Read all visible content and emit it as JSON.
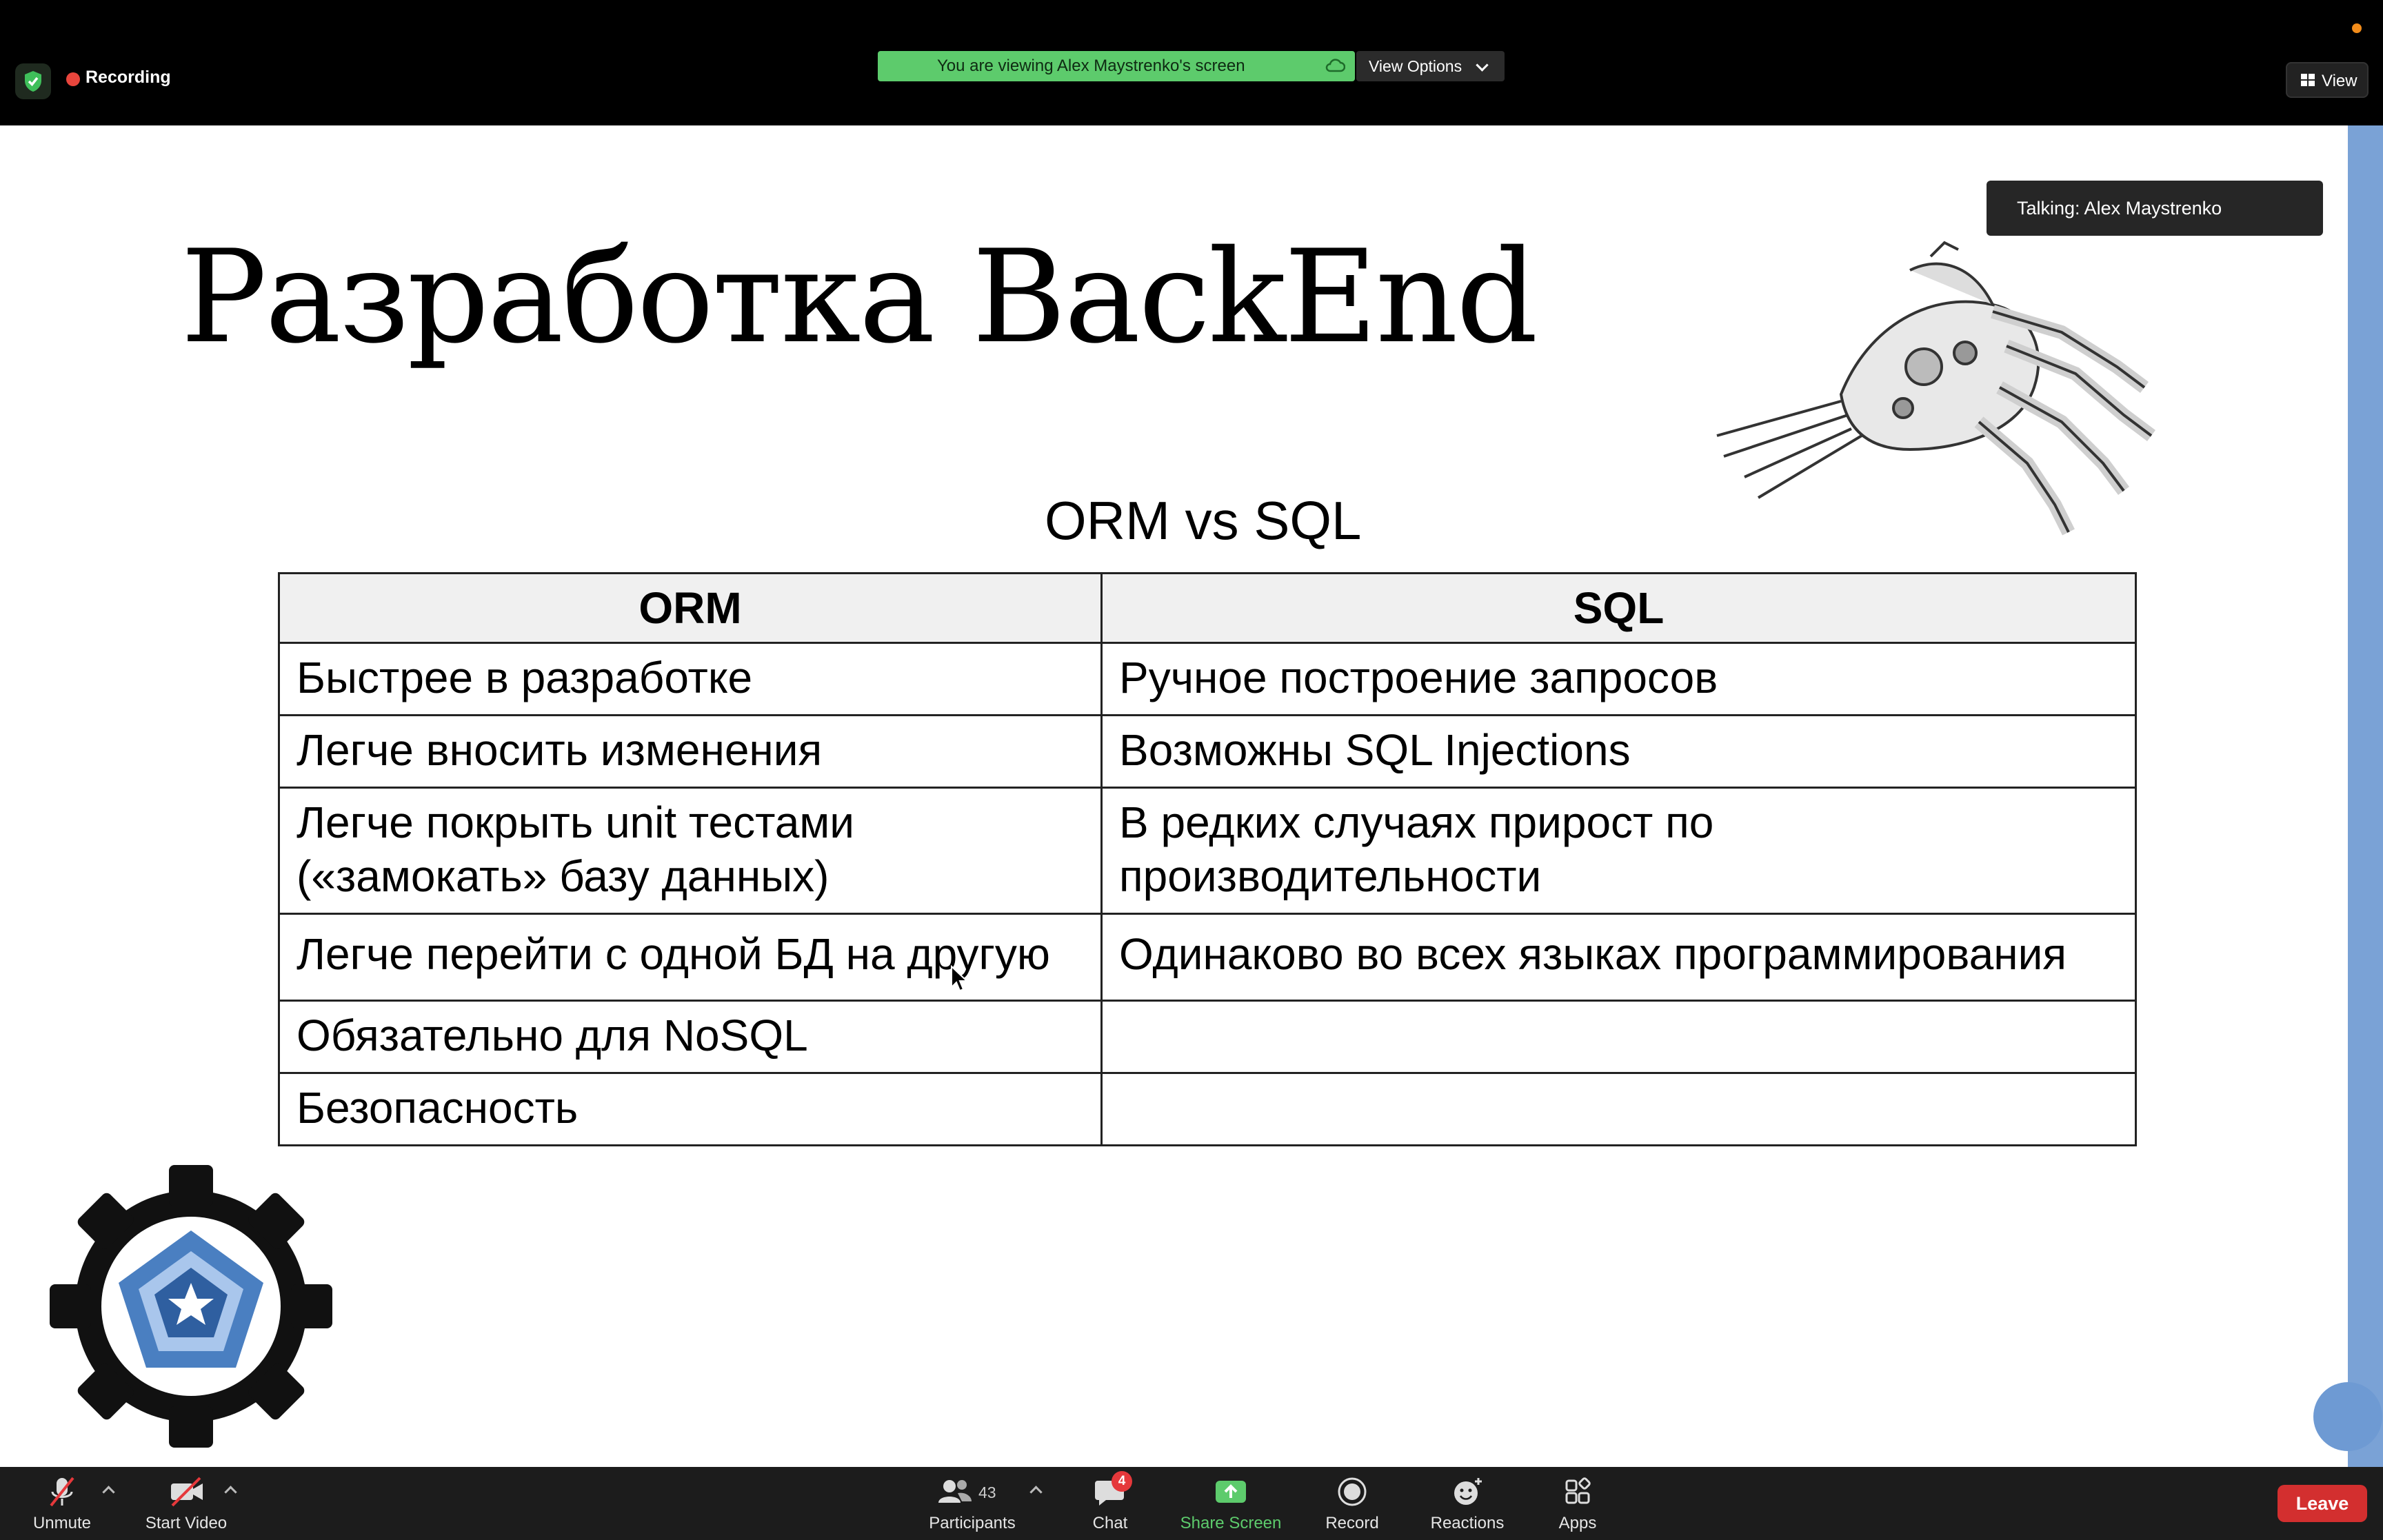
{
  "top_bar": {
    "recording_label": "Recording",
    "share_banner_text": "You are viewing Alex Maystrenko's screen",
    "view_options_label": "View Options",
    "view_button_label": "View"
  },
  "speaker": {
    "talking_label": "Talking: Alex Maystrenko"
  },
  "slide": {
    "title": "Разработка BackEnd",
    "subtitle": "ORM vs SQL",
    "table": {
      "headers": [
        "ORM",
        "SQL"
      ],
      "rows": [
        [
          "Быстрее в разработке",
          "Ручное построение запросов"
        ],
        [
          "Легче вносить изменения",
          "Возможны SQL Injections"
        ],
        [
          "Легче покрыть unit тестами («замокать» базу данных)",
          "В редких случаях прирост по производительности"
        ],
        [
          "Легче перейти с одной БД на другую",
          "Одинаково во всех языках программирования"
        ],
        [
          "Обязательно для NoSQL",
          ""
        ],
        [
          "Безопасность",
          ""
        ]
      ]
    }
  },
  "toolbar": {
    "unmute_label": "Unmute",
    "start_video_label": "Start Video",
    "participants_label": "Participants",
    "participants_count": "43",
    "chat_label": "Chat",
    "chat_badge": "4",
    "share_screen_label": "Share Screen",
    "record_label": "Record",
    "reactions_label": "Reactions",
    "apps_label": "Apps",
    "leave_label": "Leave"
  },
  "colors": {
    "share_green": "#5dcb6c",
    "leave_red": "#d32f2f",
    "toolbar_bg": "#1c1c1c",
    "slide_accent_blue": "#7aa2d6"
  },
  "icons": [
    "shield-check-icon",
    "cloud-icon",
    "chevron-down-icon",
    "grid-view-icon",
    "microphone-muted-icon",
    "video-off-icon",
    "participants-icon",
    "chat-icon",
    "share-screen-arrow-icon",
    "record-icon",
    "reactions-icon",
    "apps-icon",
    "mouse-cursor-icon"
  ]
}
